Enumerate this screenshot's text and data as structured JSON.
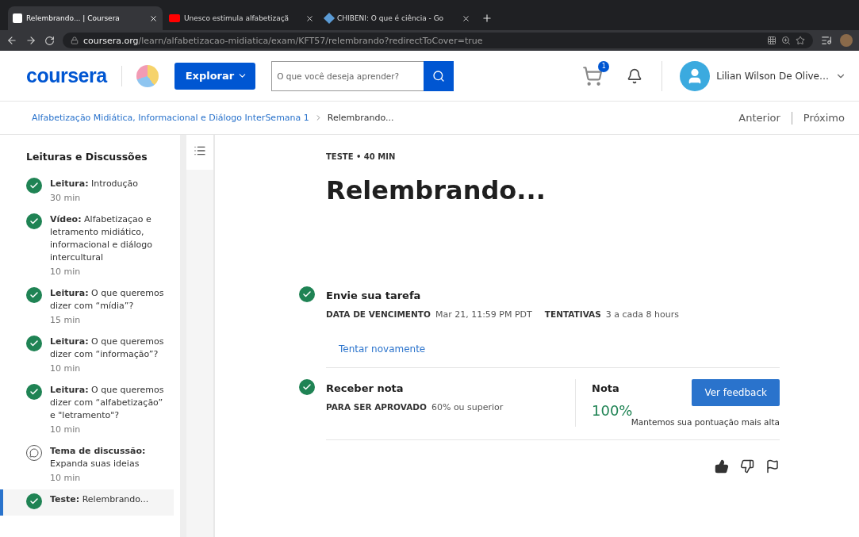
{
  "browser": {
    "tabs": [
      {
        "title": "Relembrando... | Coursera",
        "selected": true
      },
      {
        "title": "Unesco estimula alfabetizaçã",
        "selected": false
      },
      {
        "title": "CHIBENI: O que é ciência - Go",
        "selected": false
      }
    ],
    "url_host": "coursera.org",
    "url_path": "/learn/alfabetizacao-midiatica/exam/KFT57/relembrando?redirectToCover=true"
  },
  "header": {
    "logo": "coursera",
    "explore": "Explorar",
    "search": {
      "placeholder": "O que você deseja aprender?"
    },
    "cart_count": "1",
    "user": "Lilian Wilson De Olive…"
  },
  "breadcrumb": {
    "course": "Alfabetização Midiática, Informacional e Diálogo Inter",
    "week": "Semana 1",
    "current": "Relembrando...",
    "prev": "Anterior",
    "next": "Próximo"
  },
  "sidebar": {
    "title": "Leituras e Discussões",
    "items": [
      {
        "kind": "done",
        "type": "Leitura:",
        "title": "Introdução",
        "duration": "30 min",
        "selected": false
      },
      {
        "kind": "done",
        "type": "Vídeo:",
        "title": "Alfabetizaçao e letramento midiático, informacional e diálogo intercultural",
        "duration": "10 min",
        "selected": false
      },
      {
        "kind": "done",
        "type": "Leitura:",
        "title": "O que queremos dizer com “mídia”?",
        "duration": "15 min",
        "selected": false
      },
      {
        "kind": "done",
        "type": "Leitura:",
        "title": "O que queremos dizer com “informação”?",
        "duration": "10 min",
        "selected": false
      },
      {
        "kind": "done",
        "type": "Leitura:",
        "title": "O que queremos dizer com “alfabetização” e \"letramento\"?",
        "duration": "10 min",
        "selected": false
      },
      {
        "kind": "discussion",
        "type": "Tema de discussão:",
        "title": "Expanda suas ideias",
        "duration": "10 min",
        "selected": false
      },
      {
        "kind": "done",
        "type": "Teste:",
        "title": "Relembrando...",
        "selected": true
      }
    ]
  },
  "main": {
    "eyebrow": "TESTE • 40 MIN",
    "title": "Relembrando...",
    "submit": {
      "title": "Envie sua tarefa",
      "done": true,
      "due_label": "DATA DE VENCIMENTO",
      "due": "Mar 21, 11:59 PM PDT",
      "attempts_label": "TENTATIVAS",
      "attempts": "3 a cada 8 hours",
      "retry": "Tentar novamente"
    },
    "grade": {
      "title": "Receber nota",
      "done": true,
      "pass_label": "PARA SER APROVADO",
      "pass": "60% ou superior",
      "grade_label": "Nota",
      "grade": "100%",
      "feedback": "Ver feedback",
      "note": "Mantemos sua pontuação mais alta"
    },
    "liked": true
  }
}
